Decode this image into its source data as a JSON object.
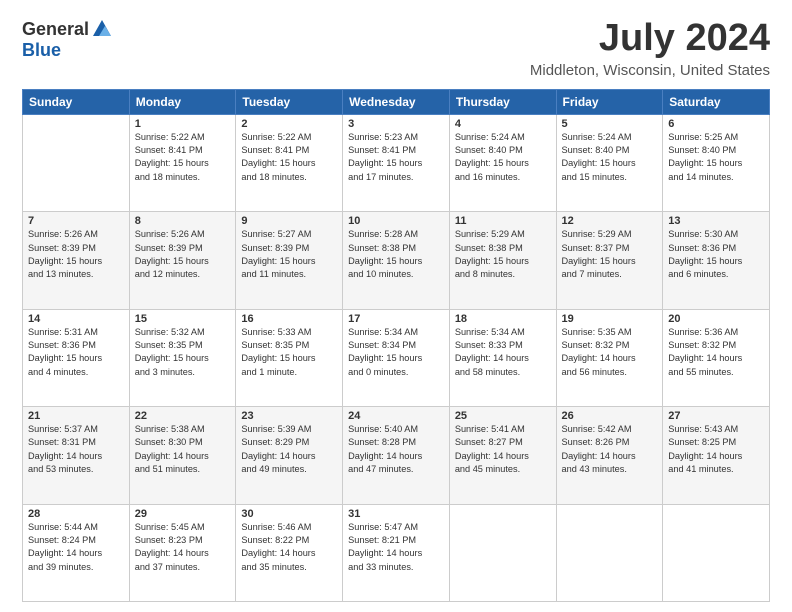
{
  "header": {
    "logo_general": "General",
    "logo_blue": "Blue",
    "title": "July 2024",
    "subtitle": "Middleton, Wisconsin, United States"
  },
  "days_of_week": [
    "Sunday",
    "Monday",
    "Tuesday",
    "Wednesday",
    "Thursday",
    "Friday",
    "Saturday"
  ],
  "weeks": [
    [
      {
        "day": "",
        "info": ""
      },
      {
        "day": "1",
        "info": "Sunrise: 5:22 AM\nSunset: 8:41 PM\nDaylight: 15 hours\nand 18 minutes."
      },
      {
        "day": "2",
        "info": "Sunrise: 5:22 AM\nSunset: 8:41 PM\nDaylight: 15 hours\nand 18 minutes."
      },
      {
        "day": "3",
        "info": "Sunrise: 5:23 AM\nSunset: 8:41 PM\nDaylight: 15 hours\nand 17 minutes."
      },
      {
        "day": "4",
        "info": "Sunrise: 5:24 AM\nSunset: 8:40 PM\nDaylight: 15 hours\nand 16 minutes."
      },
      {
        "day": "5",
        "info": "Sunrise: 5:24 AM\nSunset: 8:40 PM\nDaylight: 15 hours\nand 15 minutes."
      },
      {
        "day": "6",
        "info": "Sunrise: 5:25 AM\nSunset: 8:40 PM\nDaylight: 15 hours\nand 14 minutes."
      }
    ],
    [
      {
        "day": "7",
        "info": "Sunrise: 5:26 AM\nSunset: 8:39 PM\nDaylight: 15 hours\nand 13 minutes."
      },
      {
        "day": "8",
        "info": "Sunrise: 5:26 AM\nSunset: 8:39 PM\nDaylight: 15 hours\nand 12 minutes."
      },
      {
        "day": "9",
        "info": "Sunrise: 5:27 AM\nSunset: 8:39 PM\nDaylight: 15 hours\nand 11 minutes."
      },
      {
        "day": "10",
        "info": "Sunrise: 5:28 AM\nSunset: 8:38 PM\nDaylight: 15 hours\nand 10 minutes."
      },
      {
        "day": "11",
        "info": "Sunrise: 5:29 AM\nSunset: 8:38 PM\nDaylight: 15 hours\nand 8 minutes."
      },
      {
        "day": "12",
        "info": "Sunrise: 5:29 AM\nSunset: 8:37 PM\nDaylight: 15 hours\nand 7 minutes."
      },
      {
        "day": "13",
        "info": "Sunrise: 5:30 AM\nSunset: 8:36 PM\nDaylight: 15 hours\nand 6 minutes."
      }
    ],
    [
      {
        "day": "14",
        "info": "Sunrise: 5:31 AM\nSunset: 8:36 PM\nDaylight: 15 hours\nand 4 minutes."
      },
      {
        "day": "15",
        "info": "Sunrise: 5:32 AM\nSunset: 8:35 PM\nDaylight: 15 hours\nand 3 minutes."
      },
      {
        "day": "16",
        "info": "Sunrise: 5:33 AM\nSunset: 8:35 PM\nDaylight: 15 hours\nand 1 minute."
      },
      {
        "day": "17",
        "info": "Sunrise: 5:34 AM\nSunset: 8:34 PM\nDaylight: 15 hours\nand 0 minutes."
      },
      {
        "day": "18",
        "info": "Sunrise: 5:34 AM\nSunset: 8:33 PM\nDaylight: 14 hours\nand 58 minutes."
      },
      {
        "day": "19",
        "info": "Sunrise: 5:35 AM\nSunset: 8:32 PM\nDaylight: 14 hours\nand 56 minutes."
      },
      {
        "day": "20",
        "info": "Sunrise: 5:36 AM\nSunset: 8:32 PM\nDaylight: 14 hours\nand 55 minutes."
      }
    ],
    [
      {
        "day": "21",
        "info": "Sunrise: 5:37 AM\nSunset: 8:31 PM\nDaylight: 14 hours\nand 53 minutes."
      },
      {
        "day": "22",
        "info": "Sunrise: 5:38 AM\nSunset: 8:30 PM\nDaylight: 14 hours\nand 51 minutes."
      },
      {
        "day": "23",
        "info": "Sunrise: 5:39 AM\nSunset: 8:29 PM\nDaylight: 14 hours\nand 49 minutes."
      },
      {
        "day": "24",
        "info": "Sunrise: 5:40 AM\nSunset: 8:28 PM\nDaylight: 14 hours\nand 47 minutes."
      },
      {
        "day": "25",
        "info": "Sunrise: 5:41 AM\nSunset: 8:27 PM\nDaylight: 14 hours\nand 45 minutes."
      },
      {
        "day": "26",
        "info": "Sunrise: 5:42 AM\nSunset: 8:26 PM\nDaylight: 14 hours\nand 43 minutes."
      },
      {
        "day": "27",
        "info": "Sunrise: 5:43 AM\nSunset: 8:25 PM\nDaylight: 14 hours\nand 41 minutes."
      }
    ],
    [
      {
        "day": "28",
        "info": "Sunrise: 5:44 AM\nSunset: 8:24 PM\nDaylight: 14 hours\nand 39 minutes."
      },
      {
        "day": "29",
        "info": "Sunrise: 5:45 AM\nSunset: 8:23 PM\nDaylight: 14 hours\nand 37 minutes."
      },
      {
        "day": "30",
        "info": "Sunrise: 5:46 AM\nSunset: 8:22 PM\nDaylight: 14 hours\nand 35 minutes."
      },
      {
        "day": "31",
        "info": "Sunrise: 5:47 AM\nSunset: 8:21 PM\nDaylight: 14 hours\nand 33 minutes."
      },
      {
        "day": "",
        "info": ""
      },
      {
        "day": "",
        "info": ""
      },
      {
        "day": "",
        "info": ""
      }
    ]
  ]
}
